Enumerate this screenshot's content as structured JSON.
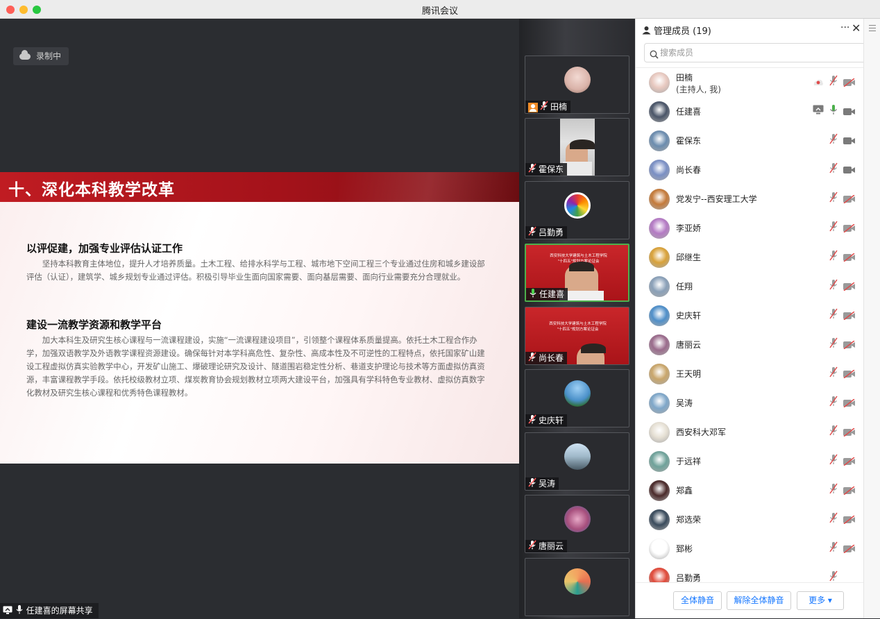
{
  "window": {
    "title": "腾讯会议"
  },
  "recording": {
    "label": "录制中"
  },
  "slide": {
    "title": "十、深化本科教学改革",
    "sections": [
      {
        "heading": "以评促建，加强专业评估认证工作",
        "body": "坚持本科教育主体地位，提升人才培养质量。土木工程、给排水科学与工程、城市地下空间工程三个专业通过住房和城乡建设部评估（认证），建筑学、城乡规划专业通过评估。积极引导毕业生面向国家需要、面向基层需要、面向行业需要充分合理就业。"
      },
      {
        "heading": "建设一流教学资源和教学平台",
        "body": "加大本科生及研究生核心课程与一流课程建设，实施“一流课程建设项目”，引领整个课程体系质量提高。依托土木工程合作办学，加强双语教学及外语教学课程资源建设。确保每针对本学科高危性、复杂性、高成本性及不可逆性的工程特点，依托国家矿山建设工程虚拟仿真实验教学中心，开发矿山施工、爆破理论研究及设计、隧道围岩稳定性分析、巷道支护理论与技术等方面虚拟仿真资源，丰富课程教学手段。依托校级教材立项、煤炭教育协会规划教材立项两大建设平台，加强具有学科特色专业教材、虚拟仿真数字化教材及研究生核心课程和优秀特色课程教材。"
      }
    ]
  },
  "screen_share": {
    "label": "任建喜的屏幕共享"
  },
  "video_tiles": [
    {
      "name": "田楠",
      "host": true,
      "muted": true
    },
    {
      "name": "霍保东",
      "muted": true
    },
    {
      "name": "吕勤勇",
      "muted": true
    },
    {
      "name": "任建喜",
      "muted": false,
      "active": true,
      "slide_line1": "西安科技大学建筑与土木工程学院",
      "slide_line2": "\"十四五\"规划方案论证会"
    },
    {
      "name": "尚长春",
      "muted": true,
      "slide_line1": "西安科技大学建筑与土木工程学院",
      "slide_line2": "\"十四五\"规划方案论证会"
    },
    {
      "name": "史庆轩",
      "muted": true
    },
    {
      "name": "吴涛",
      "muted": true
    },
    {
      "name": "唐丽云",
      "muted": true
    }
  ],
  "panel": {
    "title": "管理成员 (19)",
    "more": "···",
    "close": "✕",
    "search_placeholder": "搜索成员",
    "members": [
      {
        "name": "田楠",
        "sub": "(主持人, 我)",
        "mic": "muted",
        "cam": "off",
        "extra": "record",
        "avatar_color": "#e8c9c0"
      },
      {
        "name": "任建喜",
        "mic": "on",
        "cam": "on",
        "extra": "share",
        "avatar_color": "#4a5568"
      },
      {
        "name": "霍保东",
        "mic": "muted",
        "cam": "on",
        "avatar_color": "#6b8cae"
      },
      {
        "name": "尚长春",
        "mic": "muted",
        "cam": "on",
        "avatar_color": "#7a8fc4"
      },
      {
        "name": "党发宁--西安理工大学",
        "mic": "muted",
        "cam": "off",
        "avatar_color": "#c47a3a"
      },
      {
        "name": "李亚娇",
        "mic": "muted",
        "cam": "off",
        "avatar_color": "#b47ac4"
      },
      {
        "name": "邱继生",
        "mic": "muted",
        "cam": "off",
        "avatar_color": "#d9a23a"
      },
      {
        "name": "任翔",
        "mic": "muted",
        "cam": "off",
        "avatar_color": "#8aa0b8"
      },
      {
        "name": "史庆轩",
        "mic": "muted",
        "cam": "off",
        "avatar_color": "#4f8fc9"
      },
      {
        "name": "唐丽云",
        "mic": "muted",
        "cam": "off",
        "avatar_color": "#9a6b8c"
      },
      {
        "name": "王天明",
        "mic": "muted",
        "cam": "off",
        "avatar_color": "#c9a66b"
      },
      {
        "name": "吴涛",
        "mic": "muted",
        "cam": "off",
        "avatar_color": "#7fa7c9"
      },
      {
        "name": "西安科大邓军",
        "mic": "muted",
        "cam": "off",
        "avatar_color": "#e6e0d4"
      },
      {
        "name": "于远祥",
        "mic": "muted",
        "cam": "off",
        "avatar_color": "#6fa29a"
      },
      {
        "name": "郑鑫",
        "mic": "muted",
        "cam": "off",
        "avatar_color": "#4a2a2a"
      },
      {
        "name": "郑选荣",
        "mic": "muted",
        "cam": "off",
        "avatar_color": "#3a4b5c"
      },
      {
        "name": "郅彬",
        "mic": "muted",
        "cam": "off",
        "avatar_color": "#ffffff"
      },
      {
        "name": "吕勤勇",
        "mic": "muted",
        "cam": "none",
        "avatar_color": "#e04a3a"
      }
    ],
    "buttons": {
      "mute_all": "全体静音",
      "unmute_all": "解除全体静音",
      "more": "更多 ▾"
    }
  },
  "colors": {
    "accent": "#1677ff",
    "slide_red": "#b3161c",
    "active_green": "#4cb04c",
    "muted_red": "#e04b4b"
  }
}
